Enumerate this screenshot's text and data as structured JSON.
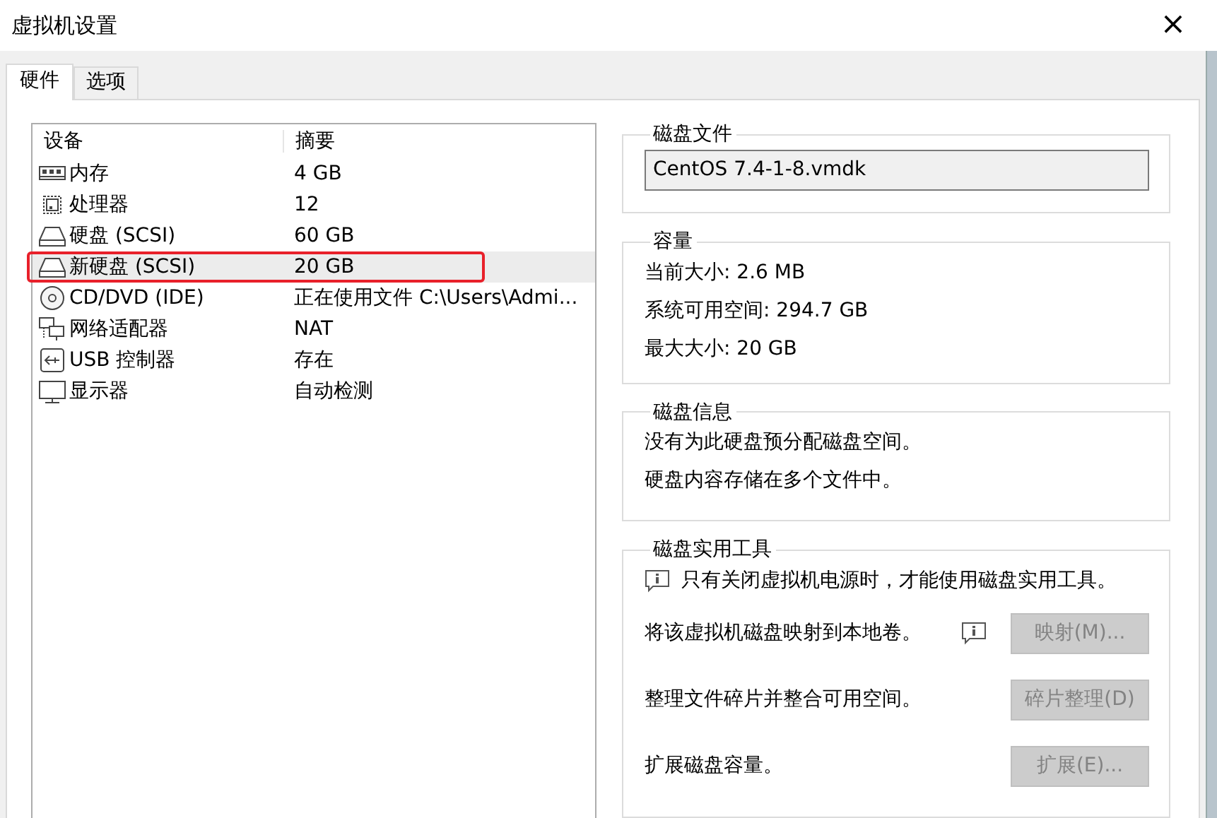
{
  "window": {
    "title": "虚拟机设置",
    "close": "×"
  },
  "tabs": [
    {
      "label": "硬件",
      "selected": true
    },
    {
      "label": "选项",
      "selected": false
    }
  ],
  "devices": {
    "columns": [
      "设备",
      "摘要"
    ],
    "rows": [
      {
        "kind": "memory",
        "device": "内存",
        "summary": "4 GB",
        "selected": false,
        "annotated": false
      },
      {
        "kind": "cpu",
        "device": "处理器",
        "summary": "12",
        "selected": false,
        "annotated": false
      },
      {
        "kind": "disk",
        "device": "硬盘 (SCSI)",
        "summary": "60 GB",
        "selected": false,
        "annotated": false
      },
      {
        "kind": "disk",
        "device": "新硬盘 (SCSI)",
        "summary": "20 GB",
        "selected": true,
        "annotated": true
      },
      {
        "kind": "cd",
        "device": "CD/DVD (IDE)",
        "summary": "正在使用文件 C:\\Users\\Admi...",
        "selected": false,
        "annotated": false
      },
      {
        "kind": "network",
        "device": "网络适配器",
        "summary": "NAT",
        "selected": false,
        "annotated": false
      },
      {
        "kind": "usb",
        "device": "USB 控制器",
        "summary": "存在",
        "selected": false,
        "annotated": false
      },
      {
        "kind": "display",
        "device": "显示器",
        "summary": "自动检测",
        "selected": false,
        "annotated": false
      }
    ]
  },
  "disk_file": {
    "title": "磁盘文件",
    "value": "CentOS 7.4-1-8.vmdk"
  },
  "capacity": {
    "title": "容量",
    "lines": [
      "当前大小: 2.6 MB",
      "系统可用空间: 294.7 GB",
      "最大大小: 20 GB"
    ]
  },
  "disk_info": {
    "title": "磁盘信息",
    "lines": [
      "没有为此硬盘预分配磁盘空间。",
      "硬盘内容存储在多个文件中。"
    ]
  },
  "utilities": {
    "title": "磁盘实用工具",
    "note": "只有关闭虚拟机电源时，才能使用磁盘实用工具。",
    "actions": [
      {
        "text": "将该虚拟机磁盘映射到本地卷。",
        "info": true,
        "button": "映射(M)...",
        "disabled": true
      },
      {
        "text": "整理文件碎片并整合可用空间。",
        "info": false,
        "button": "碎片整理(D)",
        "disabled": true
      },
      {
        "text": "扩展磁盘容量。",
        "info": false,
        "button": "扩展(E)...",
        "disabled": true
      }
    ]
  }
}
